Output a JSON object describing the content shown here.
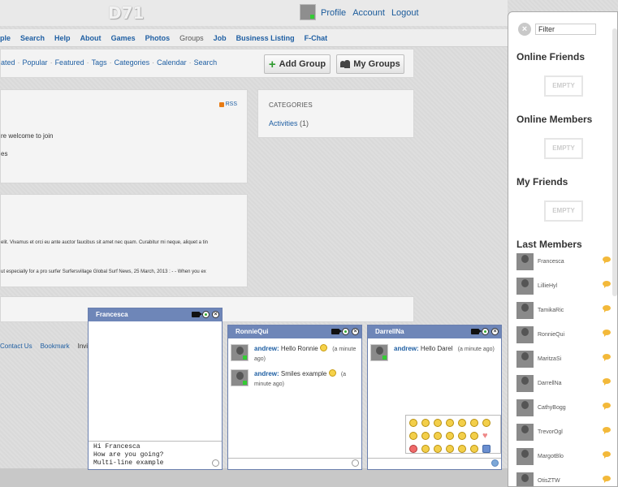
{
  "header": {
    "logo": "D71",
    "links": [
      "Profile",
      "Account",
      "Logout"
    ]
  },
  "nav": {
    "items": [
      "ple",
      "Search",
      "Help",
      "About",
      "Games",
      "Photos",
      "Groups",
      "Job",
      "Business Listing",
      "F-Chat"
    ]
  },
  "subnav": {
    "links": [
      "ated",
      "Popular",
      "Featured",
      "Tags",
      "Categories",
      "Calendar",
      "Search"
    ],
    "add_group": "Add Group",
    "my_groups": "My Groups"
  },
  "panel1": {
    "rss": "RSS",
    "line1": "re welcome to join",
    "line2": "es"
  },
  "categories": {
    "title": "CATEGORIES",
    "link": "Activities",
    "count": "(1)"
  },
  "panel2": {
    "line1": "elit. Vivamus et orci eu ante auctor faucibus sit amet nec quam. Curabitur mi neque, aliquet a tin",
    "line2": "ut especially for a pro surfer Surfersvillage Global Surf News, 25 March, 2013 : - - When you ex"
  },
  "footer": {
    "links": [
      "Contact Us",
      "Bookmark",
      "Invite f"
    ]
  },
  "chats": [
    {
      "name": "Francesca",
      "input": "Hi Francesca\nHow are you going?\nMulti-line example"
    },
    {
      "name": "RonnieQui",
      "messages": [
        {
          "who": "andrew:",
          "text": "Hello Ronnie",
          "time": "(a minute ago)"
        },
        {
          "who": "andrew:",
          "text": "Smiles example",
          "time": "(a minute ago)"
        }
      ]
    },
    {
      "name": "DarrellNa",
      "messages": [
        {
          "who": "andrew:",
          "text": "Hello Darel",
          "time": "(a minute ago)"
        }
      ]
    }
  ],
  "sidebar": {
    "filter": "Filter",
    "online_friends": "Online Friends",
    "online_members": "Online Members",
    "my_friends": "My Friends",
    "last_members": "Last Members",
    "empty": "EMPTY",
    "members": [
      "Francesca",
      "LillieHyl",
      "TamikaRic",
      "RonnieQui",
      "MaritzaSi",
      "DarrellNa",
      "CathyBogg",
      "TrevorOgl",
      "MargotBlo",
      "OtisZTW"
    ]
  },
  "colors": {
    "link": "#1f5fa3",
    "chat_header": "#6e86b8",
    "online": "#33cc33"
  }
}
